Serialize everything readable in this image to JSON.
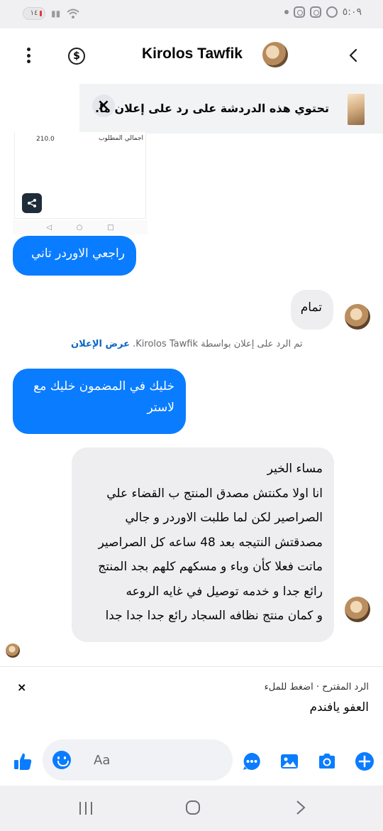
{
  "status_bar": {
    "time": "٥:٠٩",
    "battery": "١٤"
  },
  "header": {
    "contact_name": "Kirolos Tawfik"
  },
  "ad_banner": {
    "text": "تحتوي هذه الدردشة على رد على إعلان ما.",
    "close_label": "×"
  },
  "screenshot_message": {
    "total_label": "اجمالي المطلوب",
    "total_value": "210.0",
    "share_glyph": "<"
  },
  "messages": [
    {
      "direction": "outgoing",
      "text": "راجعي الاوردر تاني"
    },
    {
      "direction": "incoming",
      "text": "تمام"
    },
    {
      "direction": "outgoing",
      "text": "خليك في المضمون خليك مع لاستر"
    },
    {
      "direction": "incoming",
      "lines": [
        "مساء الخير",
        "انا اولا مكنتش مصدق المنتج ب القضاء علي",
        "الصراصير لكن لما طلبت الاوردر و جالي",
        "مصدقتش النتيجه بعد 48 ساعه كل الصراصير",
        "ماتت فعلا كأن وباء و مسكهم كلهم بجد المنتج",
        "رائع جدا و خدمه توصيل في غايه الروعه",
        "و كمان منتج نظافه السجاد رائع جدا جدا جدا"
      ]
    }
  ],
  "ad_note": {
    "text": "تم الرد على إعلان بواسطة Kirolos Tawfik.",
    "link": "عرض الإعلان"
  },
  "suggestion": {
    "label": "الرد المقترح · اضغط للملء",
    "text": "العفو يافندم",
    "close_label": "×"
  },
  "composer": {
    "placeholder": "Aa"
  },
  "icons": {
    "like": "thumbs-up-icon",
    "emoji": "emoji-icon",
    "more": "more-dots-icon",
    "gallery": "gallery-icon",
    "camera": "camera-icon",
    "add": "plus-icon"
  },
  "colors": {
    "accent": "#0a7cff",
    "incoming_bubble": "#eeeef0",
    "banner_bg": "#f2f3f5"
  }
}
